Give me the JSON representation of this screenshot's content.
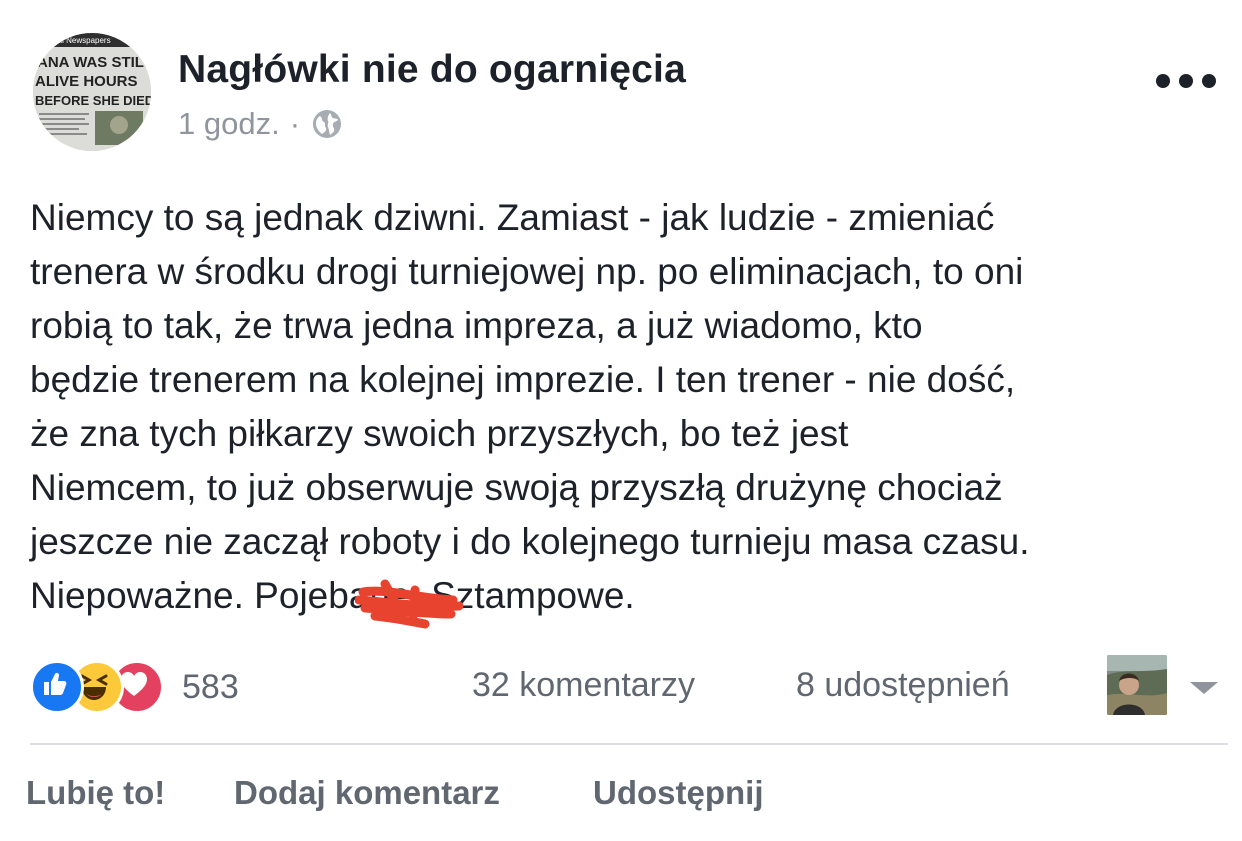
{
  "post": {
    "page_name": "Nagłówki nie do ogarnięcia",
    "timestamp": "1 godz.",
    "separator": "·",
    "privacy_icon": "globe-icon",
    "more_icon": "more-options-icon",
    "avatar_text": [
      "ANA WAS STILL",
      "ALIVE HOURS",
      "BEFORE SHE DIED"
    ],
    "avatar_masthead": "All Newspapers",
    "body_lines": [
      "Niemcy to są jednak dziwni. Zamiast - jak ludzie - zmieniać",
      "trenera w środku drogi turniejowej np. po eliminacjach, to oni",
      "robią to tak, że trwa jedna impreza, a już wiadomo, kto",
      "będzie trenerem na kolejnej imprezie. I ten trener - nie dość,",
      "że zna tych piłkarzy swoich przyszłych, bo też jest",
      "Niemcem, to już obserwuje swoją przyszłą drużynę chociaż",
      "jeszcze nie zaczął roboty i do kolejnego turnieju masa czasu.",
      "Niepoważne. Pojebane. Sztampowe."
    ]
  },
  "counts": {
    "reactions": "583",
    "reaction_icons": [
      "like-reaction-icon",
      "haha-reaction-icon",
      "love-reaction-icon"
    ],
    "comments": "32 komentarzy",
    "shares": "8 udostępnień"
  },
  "actions": {
    "like": "Lubię to!",
    "comment": "Dodaj komentarz",
    "share": "Udostępnij"
  },
  "colors": {
    "text": "#1d2129",
    "secondary": "#90949c",
    "counts": "#606770",
    "action": "#616770",
    "like_blue": "#1877f2",
    "love_red": "#e4405f",
    "haha_yellow": "#fcc93a",
    "scribble": "#e8432e"
  }
}
